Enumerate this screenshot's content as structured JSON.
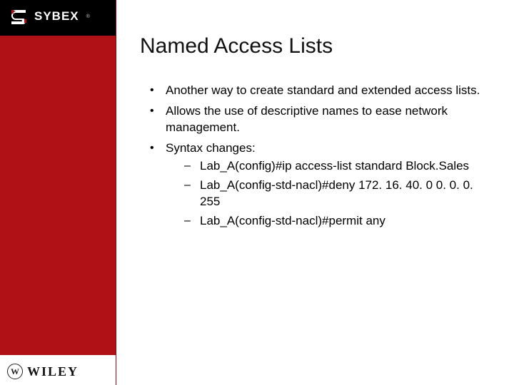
{
  "brand": {
    "name": "SYBEX",
    "trademark": "®"
  },
  "footer": {
    "symbol": "W",
    "publisher": "WILEY"
  },
  "title": "Named Access Lists",
  "bullets": [
    {
      "text": "Another way to create standard and extended access lists."
    },
    {
      "text": "Allows the use of descriptive names to ease network management."
    },
    {
      "text": "Syntax changes:",
      "sub": [
        "Lab_A(config)#ip access-list standard Block.Sales",
        "Lab_A(config-std-nacl)#deny 172. 16. 40. 0 0. 0. 0. 255",
        "Lab_A(config-std-nacl)#permit any"
      ]
    }
  ]
}
